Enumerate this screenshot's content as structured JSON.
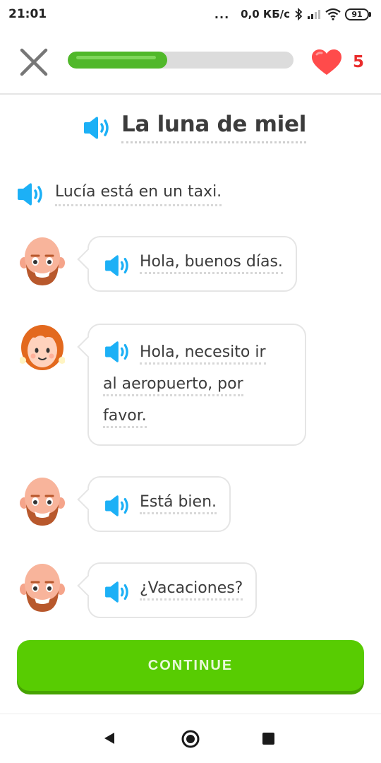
{
  "status_bar": {
    "time": "21:01",
    "dots": "...",
    "network_speed": "0,0 КБ/с",
    "battery": "91",
    "icons": [
      "bluetooth-icon",
      "signal-icon",
      "wifi-icon",
      "battery-icon"
    ]
  },
  "header": {
    "close_icon": "close-icon",
    "progress": 0.44,
    "hearts_icon": "heart-icon",
    "hearts_count": "5"
  },
  "story": {
    "title": "La luna de miel",
    "narration": "Lucía está en un taxi.",
    "lines": [
      {
        "speaker": "man",
        "text": "Hola, buenos días."
      },
      {
        "speaker": "woman",
        "text_lines": [
          "Hola, necesito ir",
          "al aeropuerto, por",
          "favor."
        ]
      },
      {
        "speaker": "man",
        "text": "Está bien."
      },
      {
        "speaker": "man",
        "text": "¿Vacaciones?"
      }
    ]
  },
  "continue_label": "CONTINUE",
  "nav": {
    "back_icon": "back-icon",
    "home_icon": "home-icon",
    "recents_icon": "recents-icon"
  },
  "colors": {
    "green": "#58cc02",
    "green_shadow": "#46a302",
    "speaker_blue": "#1cb0f6",
    "heart_red": "#ff4b4b"
  }
}
